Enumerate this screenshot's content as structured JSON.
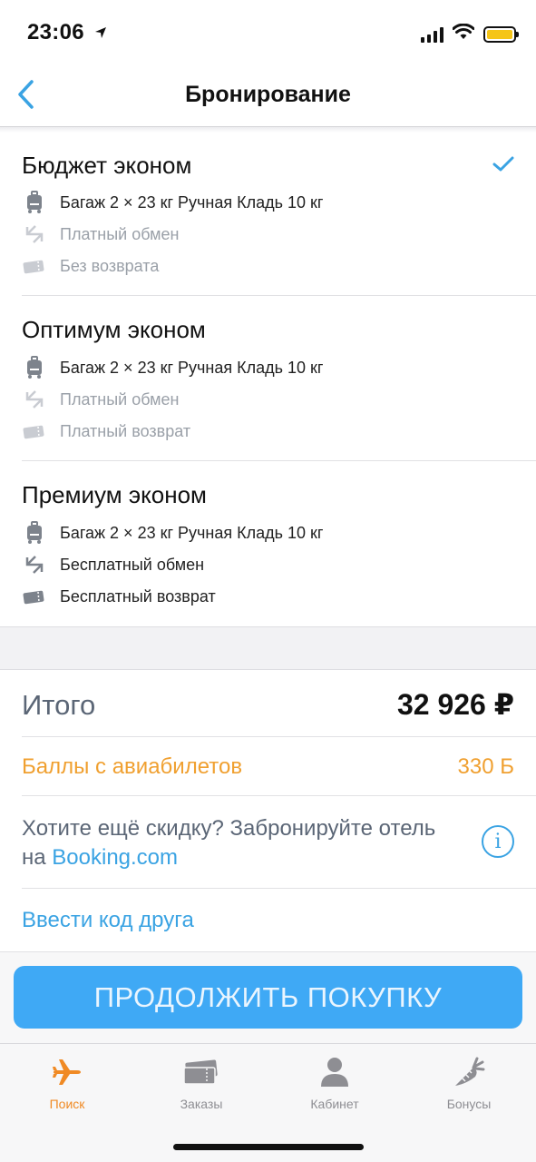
{
  "status_bar": {
    "time": "23:06",
    "battery_color": "#f5c518"
  },
  "nav": {
    "title": "Бронирование",
    "back_icon": "chevron-left-icon"
  },
  "fares": [
    {
      "title": "Бюджет эконом",
      "selected": true,
      "features": [
        {
          "icon": "luggage-icon",
          "text": "Багаж 2 × 23 кг Ручная Кладь 10 кг",
          "active": true
        },
        {
          "icon": "exchange-icon",
          "text": "Платный обмен",
          "active": false
        },
        {
          "icon": "ticket-icon",
          "text": "Без возврата",
          "active": false
        }
      ]
    },
    {
      "title": "Оптимум эконом",
      "selected": false,
      "features": [
        {
          "icon": "luggage-icon",
          "text": "Багаж 2 × 23 кг Ручная Кладь 10 кг",
          "active": true
        },
        {
          "icon": "exchange-icon",
          "text": "Платный обмен",
          "active": false
        },
        {
          "icon": "ticket-icon",
          "text": "Платный возврат",
          "active": false
        }
      ]
    },
    {
      "title": "Премиум эконом",
      "selected": false,
      "features": [
        {
          "icon": "luggage-icon",
          "text": "Багаж 2 × 23 кг Ручная Кладь 10 кг",
          "active": true
        },
        {
          "icon": "exchange-icon",
          "text": "Бесплатный обмен",
          "active": true
        },
        {
          "icon": "ticket-icon",
          "text": "Бесплатный возврат",
          "active": true
        }
      ]
    }
  ],
  "summary": {
    "total_label": "Итого",
    "total_value": "32 926 ₽",
    "points_label": "Баллы с авиабилетов",
    "points_value": "330 Б",
    "promo_text": "Хотите ещё скидку? Забронируйте отель на ",
    "promo_link": "Booking.com",
    "friend_code": "Ввести код друга"
  },
  "continue_button": "ПРОДОЛЖИТЬ ПОКУПКУ",
  "tabs": [
    {
      "label": "Поиск",
      "icon": "plane-icon",
      "active": true
    },
    {
      "label": "Заказы",
      "icon": "tickets-icon",
      "active": false
    },
    {
      "label": "Кабинет",
      "icon": "user-icon",
      "active": false
    },
    {
      "label": "Бонусы",
      "icon": "carrot-icon",
      "active": false
    }
  ],
  "colors": {
    "accent_blue": "#3aa3e3",
    "button_blue": "#3fa9f5",
    "orange": "#f08a24",
    "points_orange": "#f0a030"
  }
}
